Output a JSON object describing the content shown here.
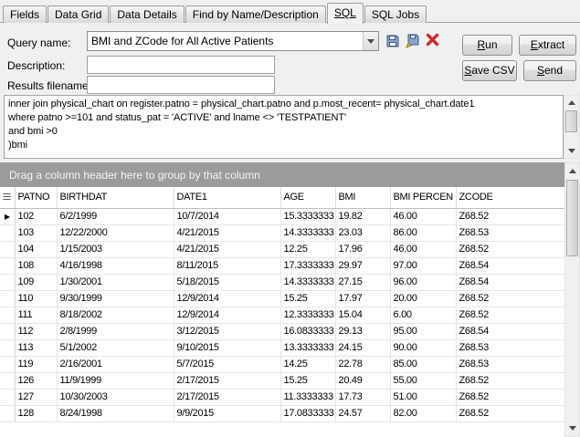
{
  "tabs": [
    {
      "label": "Fields"
    },
    {
      "label": "Data Grid"
    },
    {
      "label": "Data Details"
    },
    {
      "label": "Find by Name/Description"
    },
    {
      "label": "SQL"
    },
    {
      "label": "SQL Jobs"
    }
  ],
  "form": {
    "query_name_label": "Query name:",
    "query_name_value": "BMI and ZCode for All Active Patients",
    "description_label": "Description:",
    "description_value": "",
    "results_filename_label": "Results filename:",
    "results_filename_value": ""
  },
  "buttons": {
    "run": "Run",
    "extract": "Extract",
    "save_csv": "Save CSV",
    "send": "Send"
  },
  "icons": {
    "save": "floppy-disk-icon",
    "save_as": "floppy-disk-plus-icon",
    "delete": "red-x-icon",
    "dropdown": "chevron-down-icon"
  },
  "colors": {
    "group_bar_bg": "#9b9b9b",
    "delete_x": "#cf2a2a",
    "window_bg": "#f0f0f0"
  },
  "sql": {
    "lines": [
      "inner join physical_chart on register.patno = physical_chart.patno and p.most_recent= physical_chart.date1",
      "where patno >=101 and status_pat = 'ACTIVE' and lname <> 'TESTPATIENT'",
      "and bmi >0",
      ")bmi"
    ]
  },
  "group_bar": {
    "text": "Drag a column header here to group by that column"
  },
  "grid": {
    "columns": [
      "PATNO",
      "BIRTHDAT",
      "DATE1",
      "AGE",
      "BMI",
      "BMI PERCEN",
      "ZCODE"
    ],
    "selected_row_index": 0,
    "rows": [
      [
        "102",
        "6/2/1999",
        "10/7/2014",
        "15.3333333",
        "19.82",
        "46.00",
        "Z68.52"
      ],
      [
        "103",
        "12/22/2000",
        "4/21/2015",
        "14.3333333",
        "23.03",
        "86.00",
        "Z68.53"
      ],
      [
        "104",
        "1/15/2003",
        "4/21/2015",
        "12.25",
        "17.96",
        "46.00",
        "Z68.52"
      ],
      [
        "108",
        "4/16/1998",
        "8/11/2015",
        "17.3333333",
        "29.97",
        "97.00",
        "Z68.54"
      ],
      [
        "109",
        "1/30/2001",
        "5/18/2015",
        "14.3333333",
        "27.15",
        "96.00",
        "Z68.54"
      ],
      [
        "110",
        "9/30/1999",
        "12/9/2014",
        "15.25",
        "17.97",
        "20.00",
        "Z68.52"
      ],
      [
        "111",
        "8/18/2002",
        "12/9/2014",
        "12.3333333",
        "15.04",
        "6.00",
        "Z68.52"
      ],
      [
        "112",
        "2/8/1999",
        "3/12/2015",
        "16.0833333",
        "29.13",
        "95.00",
        "Z68.54"
      ],
      [
        "113",
        "5/1/2002",
        "9/10/2015",
        "13.3333333",
        "24.15",
        "90.00",
        "Z68.53"
      ],
      [
        "119",
        "2/16/2001",
        "5/7/2015",
        "14.25",
        "22.78",
        "85.00",
        "Z68.53"
      ],
      [
        "126",
        "11/9/1999",
        "2/17/2015",
        "15.25",
        "20.49",
        "55.00",
        "Z68.52"
      ],
      [
        "127",
        "10/30/2003",
        "2/17/2015",
        "11.3333333",
        "17.73",
        "51.00",
        "Z68.52"
      ],
      [
        "128",
        "8/24/1998",
        "9/9/2015",
        "17.0833333",
        "24.57",
        "82.00",
        "Z68.52"
      ]
    ]
  }
}
